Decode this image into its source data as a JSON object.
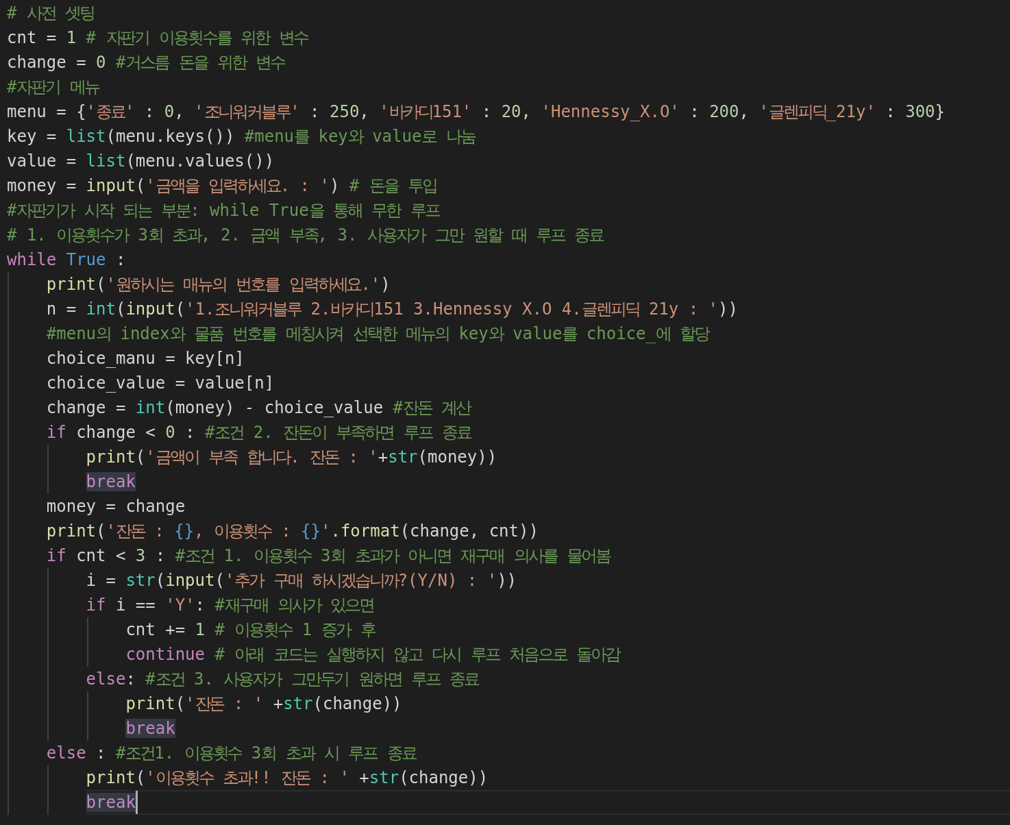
{
  "lines": [
    {
      "current": false,
      "tokens": [
        {
          "kind": "comment",
          "text": "# 사전 셋팅"
        }
      ]
    },
    {
      "current": false,
      "tokens": [
        {
          "kind": "plain",
          "text": "cnt = "
        },
        {
          "kind": "number",
          "text": "1 "
        },
        {
          "kind": "comment",
          "text": "# 자판기 이용횟수를 위한 변수"
        }
      ]
    },
    {
      "current": false,
      "tokens": [
        {
          "kind": "plain",
          "text": "change = "
        },
        {
          "kind": "number",
          "text": "0 "
        },
        {
          "kind": "comment",
          "text": "#거스름 돈을 위한 변수"
        }
      ]
    },
    {
      "current": false,
      "tokens": [
        {
          "kind": "comment",
          "text": "#자판기 메뉴"
        }
      ]
    },
    {
      "current": false,
      "tokens": [
        {
          "kind": "plain",
          "text": "menu = {"
        },
        {
          "kind": "string",
          "text": "'종료'"
        },
        {
          "kind": "plain",
          "text": " : "
        },
        {
          "kind": "number",
          "text": "0"
        },
        {
          "kind": "plain",
          "text": ", "
        },
        {
          "kind": "string",
          "text": "'조니워커블루'"
        },
        {
          "kind": "plain",
          "text": " : "
        },
        {
          "kind": "number",
          "text": "250"
        },
        {
          "kind": "plain",
          "text": ", "
        },
        {
          "kind": "string",
          "text": "'바카디151'"
        },
        {
          "kind": "plain",
          "text": " : "
        },
        {
          "kind": "number",
          "text": "20"
        },
        {
          "kind": "plain",
          "text": ", "
        },
        {
          "kind": "string",
          "text": "'Hennessy_X.O'"
        },
        {
          "kind": "plain",
          "text": " : "
        },
        {
          "kind": "number",
          "text": "200"
        },
        {
          "kind": "plain",
          "text": ", "
        },
        {
          "kind": "string",
          "text": "'글렌피딕_21y'"
        },
        {
          "kind": "plain",
          "text": " : "
        },
        {
          "kind": "number",
          "text": "300"
        },
        {
          "kind": "plain",
          "text": "}"
        }
      ]
    },
    {
      "current": false,
      "tokens": [
        {
          "kind": "plain",
          "text": "key = "
        },
        {
          "kind": "builtin",
          "text": "list"
        },
        {
          "kind": "plain",
          "text": "(menu.keys()) "
        },
        {
          "kind": "comment",
          "text": "#menu를 key와 value로 나눔"
        }
      ]
    },
    {
      "current": false,
      "tokens": [
        {
          "kind": "plain",
          "text": "value = "
        },
        {
          "kind": "builtin",
          "text": "list"
        },
        {
          "kind": "plain",
          "text": "(menu.values())"
        }
      ]
    },
    {
      "current": false,
      "tokens": [
        {
          "kind": "plain",
          "text": "money = "
        },
        {
          "kind": "function",
          "text": "input"
        },
        {
          "kind": "plain",
          "text": "("
        },
        {
          "kind": "string",
          "text": "'금액을 입력하세요. : '"
        },
        {
          "kind": "plain",
          "text": ") "
        },
        {
          "kind": "comment",
          "text": "# 돈을 투입"
        }
      ]
    },
    {
      "current": false,
      "tokens": [
        {
          "kind": "comment",
          "text": "#자판기가 시작 되는 부분: while True을 통해 무한 루프"
        }
      ]
    },
    {
      "current": false,
      "tokens": [
        {
          "kind": "comment",
          "text": "# 1. 이용횟수가 3회 초과, 2. 금액 부족, 3. 사용자가 그만 원할 때 루프 종료"
        }
      ]
    },
    {
      "current": false,
      "tokens": [
        {
          "kind": "keyword",
          "text": "while "
        },
        {
          "kind": "constant",
          "text": "True"
        },
        {
          "kind": "plain",
          "text": " :"
        }
      ],
      "children": [
        {
          "current": false,
          "tokens": [
            {
              "kind": "function",
              "text": "print"
            },
            {
              "kind": "plain",
              "text": "("
            },
            {
              "kind": "string",
              "text": "'원하시는 매뉴의 번호를 입력하세요.'"
            },
            {
              "kind": "plain",
              "text": ")"
            }
          ]
        },
        {
          "current": false,
          "tokens": [
            {
              "kind": "plain",
              "text": "n = "
            },
            {
              "kind": "builtin",
              "text": "int"
            },
            {
              "kind": "plain",
              "text": "("
            },
            {
              "kind": "function",
              "text": "input"
            },
            {
              "kind": "plain",
              "text": "("
            },
            {
              "kind": "string",
              "text": "'1.조니워커블루 2.바카디151 3.Hennessy X.O 4.글렌피딕 21y : '"
            },
            {
              "kind": "plain",
              "text": "))"
            }
          ]
        },
        {
          "current": false,
          "tokens": [
            {
              "kind": "comment",
              "text": "#menu의 index와 물품 번호를 메칭시켜 선택한 메뉴의 key와 value를 choice_에 할당"
            }
          ]
        },
        {
          "current": false,
          "tokens": [
            {
              "kind": "plain",
              "text": "choice_manu = key[n]"
            }
          ]
        },
        {
          "current": false,
          "tokens": [
            {
              "kind": "plain",
              "text": "choice_value = value[n]"
            }
          ]
        },
        {
          "current": false,
          "tokens": [
            {
              "kind": "plain",
              "text": "change = "
            },
            {
              "kind": "builtin",
              "text": "int"
            },
            {
              "kind": "plain",
              "text": "(money) - choice_value "
            },
            {
              "kind": "comment",
              "text": "#잔돈 계산"
            }
          ]
        },
        {
          "current": false,
          "tokens": [
            {
              "kind": "keyword",
              "text": "if"
            },
            {
              "kind": "plain",
              "text": " change < "
            },
            {
              "kind": "number",
              "text": "0"
            },
            {
              "kind": "plain",
              "text": " : "
            },
            {
              "kind": "comment",
              "text": "#조건 2. 잔돈이 부족하면 루프 종료"
            }
          ],
          "children": [
            {
              "current": false,
              "tokens": [
                {
                  "kind": "function",
                  "text": "print"
                },
                {
                  "kind": "plain",
                  "text": "("
                },
                {
                  "kind": "string",
                  "text": "'금액이 부족 합니다. 잔돈 : '"
                },
                {
                  "kind": "plain",
                  "text": "+"
                },
                {
                  "kind": "builtin",
                  "text": "str"
                },
                {
                  "kind": "plain",
                  "text": "(money))"
                }
              ]
            },
            {
              "current": false,
              "tokens": [
                {
                  "kind": "match",
                  "text": "break"
                }
              ]
            }
          ]
        },
        {
          "current": false,
          "tokens": [
            {
              "kind": "plain",
              "text": "money = change"
            }
          ]
        },
        {
          "current": false,
          "tokens": [
            {
              "kind": "function",
              "text": "print"
            },
            {
              "kind": "plain",
              "text": "("
            },
            {
              "kind": "string",
              "text": "'잔돈 : "
            },
            {
              "kind": "placeholder",
              "text": "{}"
            },
            {
              "kind": "string",
              "text": ", 이용횟수 : "
            },
            {
              "kind": "placeholder",
              "text": "{}"
            },
            {
              "kind": "string",
              "text": "'"
            },
            {
              "kind": "plain",
              "text": "."
            },
            {
              "kind": "function",
              "text": "format"
            },
            {
              "kind": "plain",
              "text": "(change, cnt))"
            }
          ]
        },
        {
          "current": false,
          "tokens": [
            {
              "kind": "keyword",
              "text": "if"
            },
            {
              "kind": "plain",
              "text": " cnt < "
            },
            {
              "kind": "number",
              "text": "3"
            },
            {
              "kind": "plain",
              "text": " : "
            },
            {
              "kind": "comment",
              "text": "#조건 1. 이용횟수 3회 초과가 아니면 재구매 의사를 물어봄"
            }
          ],
          "children": [
            {
              "current": false,
              "tokens": [
                {
                  "kind": "plain",
                  "text": "i = "
                },
                {
                  "kind": "builtin",
                  "text": "str"
                },
                {
                  "kind": "plain",
                  "text": "("
                },
                {
                  "kind": "function",
                  "text": "input"
                },
                {
                  "kind": "plain",
                  "text": "("
                },
                {
                  "kind": "string",
                  "text": "'추가 구매 하시겠습니까?(Y/N) : '"
                },
                {
                  "kind": "plain",
                  "text": "))"
                }
              ]
            },
            {
              "current": false,
              "tokens": [
                {
                  "kind": "keyword",
                  "text": "if"
                },
                {
                  "kind": "plain",
                  "text": " i == "
                },
                {
                  "kind": "string",
                  "text": "'Y'"
                },
                {
                  "kind": "plain",
                  "text": ": "
                },
                {
                  "kind": "comment",
                  "text": "#재구매 의사가 있으면"
                }
              ],
              "children": [
                {
                  "current": false,
                  "tokens": [
                    {
                      "kind": "plain",
                      "text": "cnt += "
                    },
                    {
                      "kind": "number",
                      "text": "1 "
                    },
                    {
                      "kind": "comment",
                      "text": "# 이용횟수 1 증가 후"
                    }
                  ]
                },
                {
                  "current": false,
                  "tokens": [
                    {
                      "kind": "keyword",
                      "text": "continue "
                    },
                    {
                      "kind": "comment",
                      "text": "# 아래 코드는 실행하지 않고 다시 루프 처음으로 돌아감"
                    }
                  ]
                }
              ]
            },
            {
              "current": false,
              "tokens": [
                {
                  "kind": "keyword",
                  "text": "else"
                },
                {
                  "kind": "plain",
                  "text": ": "
                },
                {
                  "kind": "comment",
                  "text": "#조건 3. 사용자가 그만두기 원하면 루프 종료"
                }
              ],
              "children": [
                {
                  "current": false,
                  "tokens": [
                    {
                      "kind": "function",
                      "text": "print"
                    },
                    {
                      "kind": "plain",
                      "text": "("
                    },
                    {
                      "kind": "string",
                      "text": "'잔돈 : '"
                    },
                    {
                      "kind": "plain",
                      "text": " +"
                    },
                    {
                      "kind": "builtin",
                      "text": "str"
                    },
                    {
                      "kind": "plain",
                      "text": "(change))"
                    }
                  ]
                },
                {
                  "current": false,
                  "tokens": [
                    {
                      "kind": "match",
                      "text": "break"
                    }
                  ]
                }
              ]
            }
          ]
        },
        {
          "current": false,
          "tokens": [
            {
              "kind": "keyword",
              "text": "else"
            },
            {
              "kind": "plain",
              "text": " : "
            },
            {
              "kind": "comment",
              "text": "#조건1. 이용횟수 3회 초과 시 루프 종료"
            }
          ],
          "children": [
            {
              "current": false,
              "tokens": [
                {
                  "kind": "function",
                  "text": "print"
                },
                {
                  "kind": "plain",
                  "text": "("
                },
                {
                  "kind": "string",
                  "text": "'이용횟수 초과!! 잔돈 : '"
                },
                {
                  "kind": "plain",
                  "text": " +"
                },
                {
                  "kind": "builtin",
                  "text": "str"
                },
                {
                  "kind": "plain",
                  "text": "(change))"
                }
              ]
            },
            {
              "current": true,
              "tokens": [
                {
                  "kind": "match",
                  "text": "break"
                }
              ]
            }
          ]
        }
      ]
    }
  ]
}
